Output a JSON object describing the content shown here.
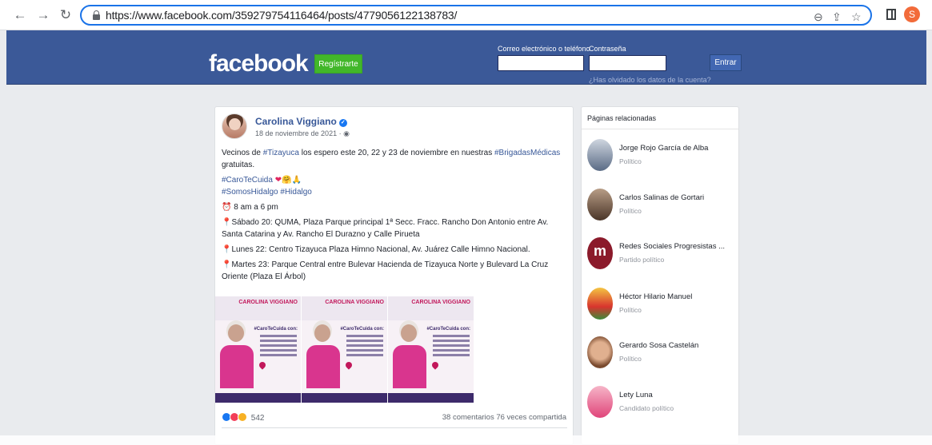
{
  "browser": {
    "url": "https://www.facebook.com/359279754116464/posts/4779056122138783/",
    "profile_initial": "S",
    "icons": [
      "back-icon",
      "forward-icon",
      "reload-icon",
      "lock-icon",
      "zoom-icon",
      "share-icon",
      "star-icon",
      "sidebar-icon"
    ]
  },
  "header": {
    "logo": "facebook",
    "register_label": "Regístrarte",
    "email_label": "Correo electrónico o teléfono",
    "password_label": "Contraseña",
    "login_label": "Entrar",
    "forgot_label": "¿Has olvidado los datos de la cuenta?",
    "colors": {
      "bar": "#3b5998",
      "register": "#42b72a"
    }
  },
  "post": {
    "author": "Carolina Viggiano",
    "date": "18 de noviembre de 2021 · ",
    "line1_pre": "Vecinos de ",
    "line1_tag": "#Tizayuca",
    "line1_mid": " los espero este 20, 22 y 23 de noviembre en nuestras ",
    "line1_tag2": "#BrigadasMédicas",
    "line1_post": " gratuitas.",
    "hashtag1": "#CaroTeCuida",
    "hashtag2": "#SomosHidalgo",
    "hashtag3": "#Hidalgo",
    "hours": "8 am a 6 pm",
    "item1": "Sábado 20: QUMA, Plaza Parque principal 1ª Secc. Fracc. Rancho Don Antonio entre Av. Santa Catarina y Av. Rancho El Durazno y Calle Pirueta",
    "item2": "Lunes 22: Centro Tizayuca Plaza Himno Nacional, Av. Juárez Calle Himno Nacional.",
    "item3": "Martes 23: Parque Central entre Bulevar Hacienda de Tizayuca Norte y Bulevard La Cruz Oriente (Plaza El Árbol)",
    "flyer_brand": "CAROLINA VIGGIANO",
    "flyer_tag": "#CaroTeCuida con:",
    "reaction_count": "542",
    "stats": "38 comentarios 76 veces compartida"
  },
  "sidebar": {
    "title": "Páginas relacionadas",
    "pages": [
      {
        "name": "Jorge Rojo García de Alba",
        "category": "Político"
      },
      {
        "name": "Carlos Salinas de Gortari",
        "category": "Político"
      },
      {
        "name": "Redes Sociales Progresistas ...",
        "category": "Partido político"
      },
      {
        "name": "Héctor Hilario Manuel",
        "category": "Político"
      },
      {
        "name": "Gerardo Sosa Castelán",
        "category": "Político"
      },
      {
        "name": "Lety Luna",
        "category": "Candidato político"
      }
    ]
  }
}
